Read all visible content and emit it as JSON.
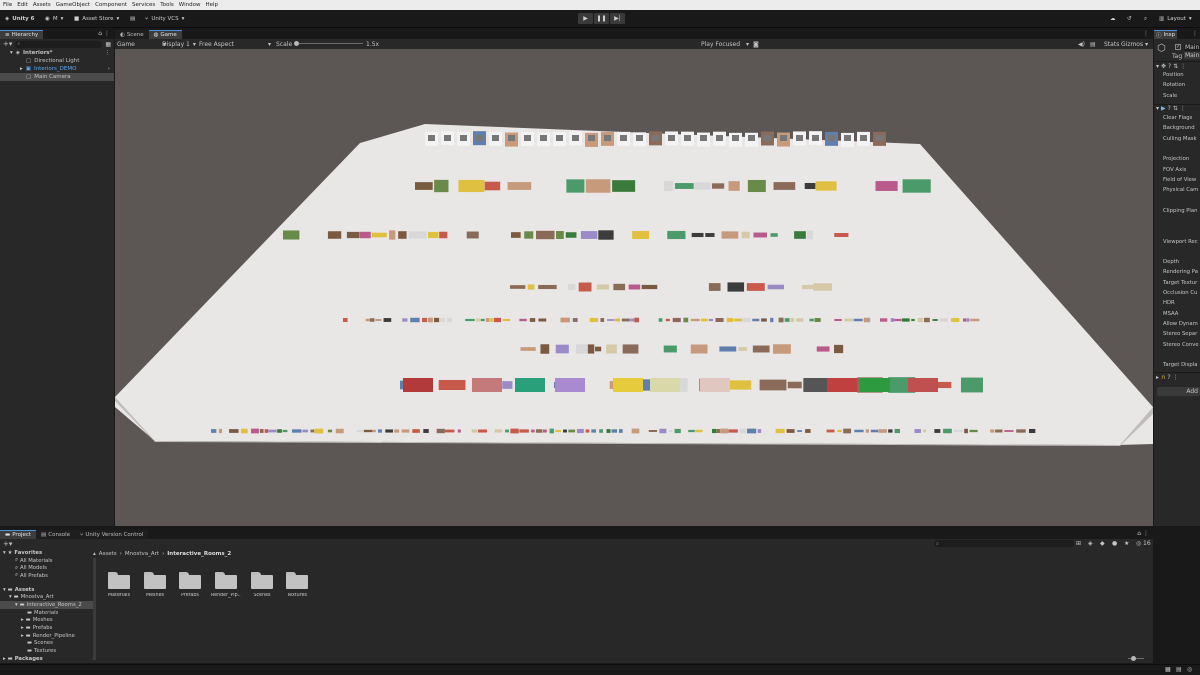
{
  "menu": [
    "File",
    "Edit",
    "Assets",
    "GameObject",
    "Component",
    "Services",
    "Tools",
    "Window",
    "Help"
  ],
  "toolbar": {
    "unity": "Unity 6",
    "account": "M",
    "asset_store": "Asset Store",
    "vcs": "Unity VCS",
    "layout": "Layout"
  },
  "hierarchy": {
    "tab": "Hierarchy",
    "scene": "Interiors*",
    "items": [
      "Directional Light",
      "Interiors_DEMO",
      "Main Camera"
    ]
  },
  "view": {
    "tab_scene": "Scene",
    "tab_game": "Game",
    "game_dropdown": "Game",
    "display": "Display 1",
    "aspect": "Free Aspect",
    "scale_label": "Scale",
    "scale_value": "1.5x",
    "play_focused": "Play Focused",
    "stats": "Stats",
    "gizmos": "Gizmos"
  },
  "inspector": {
    "tab": "Insp",
    "object_name": "Main",
    "tag_label": "Tag",
    "tag_value": "Main",
    "transform": [
      "Position",
      "Rotation",
      "Scale"
    ],
    "camera": [
      "Clear Flags",
      "Background",
      "Culling Mask",
      "",
      "Projection",
      "FOV Axis",
      "Field of View",
      "Physical Cam",
      "",
      "Clipping Plan",
      "",
      "",
      "Viewport Rec",
      "",
      "Depth",
      "Rendering Pa",
      "Target Textur",
      "Occlusion Cu",
      "HDR",
      "MSAA",
      "Allow Dynam",
      "Stereo Separ",
      "Stereo Conve",
      "",
      "Target Displa"
    ],
    "add_component": "Add"
  },
  "bottom": {
    "tabs": [
      "Project",
      "Console",
      "Unity Version Control"
    ],
    "counter": "16",
    "favorites_label": "Favorites",
    "favorites": [
      "All Materials",
      "All Models",
      "All Prefabs"
    ],
    "assets_label": "Assets",
    "tree": [
      "Mnostva_Art",
      "Interactive_Rooms_2",
      "Materials",
      "Meshes",
      "Prefabs",
      "Render_Pipeline",
      "Scenes",
      "Textures"
    ],
    "packages_label": "Packages",
    "breadcrumb": [
      "Assets",
      "Mnostva_Art",
      "Interactive_Rooms_2"
    ],
    "folders": [
      "Materials",
      "Meshes",
      "Prefabs",
      "Render_Pip...",
      "Scenes",
      "Textures"
    ]
  },
  "colors": {
    "accent": "#4d8fd6",
    "highlight_text": "#5aa9f0",
    "game_background": "#5c5654",
    "floor": "#e9e6e6"
  }
}
